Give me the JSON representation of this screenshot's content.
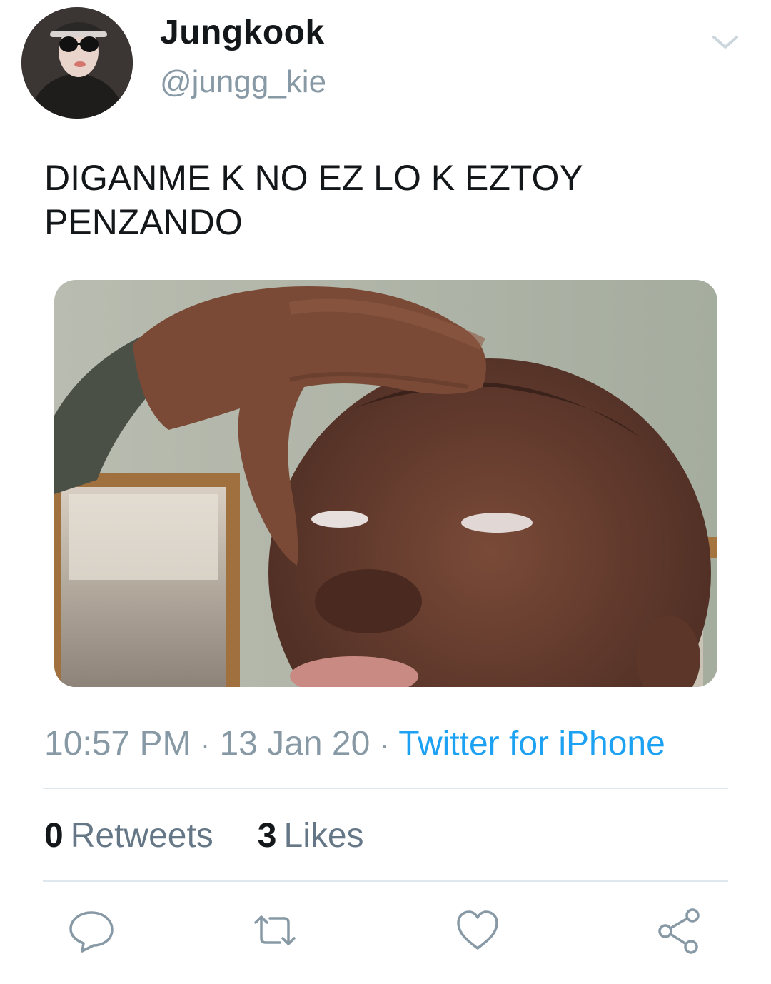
{
  "tweet": {
    "display_name": "Jungkook",
    "handle": "@jungg_kie",
    "text": "DIGANME K NO EZ LO K EZTOY\nPENZANDO",
    "time": "10:57 PM",
    "date": "13 Jan 20",
    "separator": "·",
    "source": "Twitter for iPhone",
    "retweets_count": "0",
    "retweets_label": "Retweets",
    "likes_count": "3",
    "likes_label": "Likes"
  },
  "icons": {
    "menu": "chevron-down-icon",
    "reply": "reply-icon",
    "retweet": "retweet-icon",
    "like": "heart-icon",
    "share": "share-icon"
  },
  "colors": {
    "text": "#14171a",
    "secondary": "#8899a6",
    "link": "#1da1f2",
    "divider": "#e1e8ed"
  }
}
